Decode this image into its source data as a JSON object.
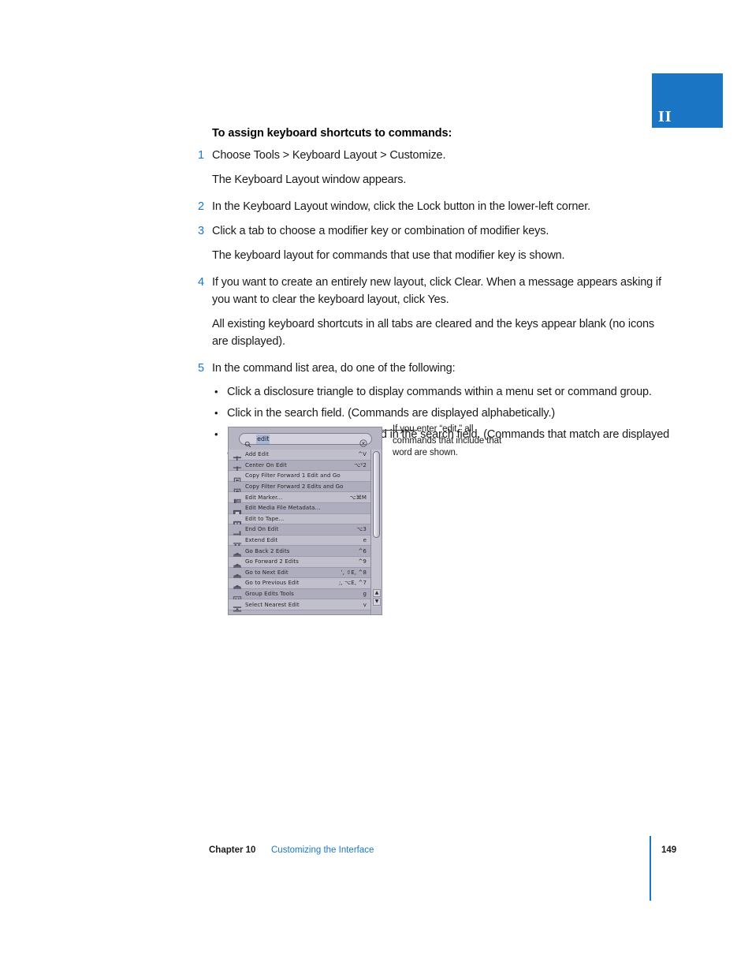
{
  "chapter_tab": {
    "numeral": "II",
    "color": "#1a76c4"
  },
  "procedure": {
    "heading": "To assign keyboard shortcuts to commands:",
    "steps": [
      {
        "num": "1",
        "text": "Choose Tools > Keyboard Layout > Customize."
      },
      {
        "num": "2",
        "text": "In the Keyboard Layout window, click the Lock button in the lower-left corner."
      },
      {
        "num": "3",
        "text": "Click a tab to choose a modifier key or combination of modifier keys."
      },
      {
        "num": "4",
        "text": "If you want to create an entirely new layout, click Clear. When a message appears asking if you want to clear the keyboard layout, click Yes."
      },
      {
        "num": "5",
        "text": "In the command list area, do one of the following:"
      }
    ],
    "result_1": "The Keyboard Layout window appears.",
    "result_3": "The keyboard layout for commands that use that modifier key is shown.",
    "result_4": "All existing keyboard shortcuts in all tabs are cleared and the keys appear blank (no icons are displayed).",
    "bullets": [
      "Click a disclosure triangle to display commands within a menu set or command group.",
      "Click in the search field. (Commands are displayed alphabetically.)",
      "Enter the name of the command in the search field. (Commands that match are displayed automatically.)"
    ],
    "bullet_glyph": "•"
  },
  "figure": {
    "callout": "If you enter “edit,” all commands that include that word are shown.",
    "search": {
      "value": "edit",
      "search_icon": "search-icon",
      "clear_icon": "clear-icon"
    },
    "commands": [
      {
        "label": "Add Edit",
        "key": "^V",
        "icon": "add-edit-icon"
      },
      {
        "label": "Center On Edit",
        "key": "⌥²2",
        "icon": "center-on-edit-icon"
      },
      {
        "label": "Copy Filter Forward 1 Edit and Go",
        "key": "",
        "icon": "copy-filter-icon"
      },
      {
        "label": "Copy Filter Forward 2 Edits and Go",
        "key": "",
        "icon": "copy-filter-icon"
      },
      {
        "label": "Edit Marker...",
        "key": "⌥⌘M",
        "icon": "edit-marker-icon"
      },
      {
        "label": "Edit Media File Metadata...",
        "key": "",
        "icon": "edit-metadata-icon"
      },
      {
        "label": "Edit to Tape...",
        "key": "",
        "icon": "edit-to-tape-icon"
      },
      {
        "label": "End On Edit",
        "key": "⌥3",
        "icon": "end-on-edit-icon"
      },
      {
        "label": "Extend Edit",
        "key": "e",
        "icon": "extend-edit-icon"
      },
      {
        "label": "Go Back 2 Edits",
        "key": "^6",
        "icon": "go-back-icon"
      },
      {
        "label": "Go Forward 2 Edits",
        "key": "^9",
        "icon": "go-forward-icon"
      },
      {
        "label": "Go to Next Edit",
        "key": "’, ⇧E, ^8",
        "icon": "go-next-icon"
      },
      {
        "label": "Go to Previous Edit",
        "key": ";, ⌥E, ^7",
        "icon": "go-previous-icon"
      },
      {
        "label": "Group Edits Tools",
        "key": "g",
        "icon": "group-edits-icon"
      },
      {
        "label": "Select Nearest Edit",
        "key": "v",
        "icon": "select-nearest-icon"
      }
    ],
    "scroll_up_glyph": "▲",
    "scroll_down_glyph": "▼"
  },
  "footer": {
    "chapter": "Chapter 10",
    "title": "Customizing the Interface",
    "page": "149"
  }
}
